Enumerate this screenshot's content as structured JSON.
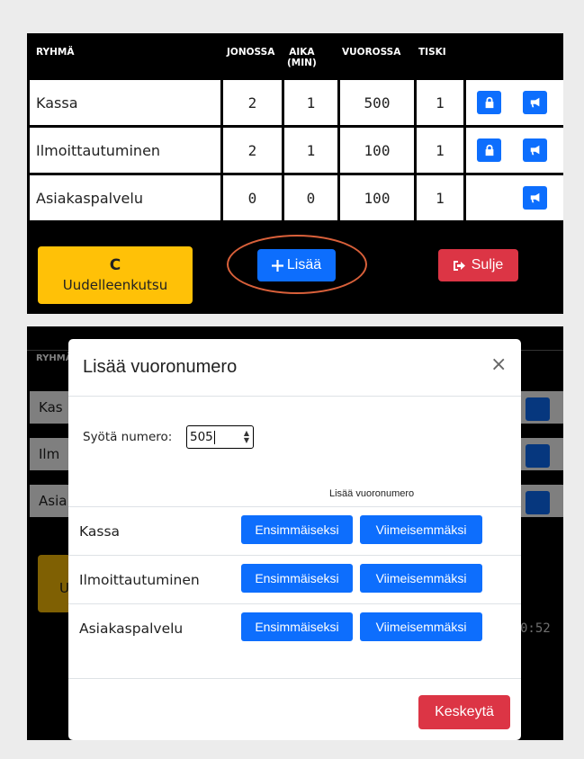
{
  "queue_table": {
    "headers": {
      "group": "RYHMÄ",
      "in_queue": "JONOSSA",
      "time_line1": "AIKA",
      "time_line2": "(MIN)",
      "current": "VUOROSSA",
      "counter": "TISKI"
    },
    "rows": [
      {
        "name": "Kassa",
        "in_queue": "2",
        "time": "1",
        "current": "500",
        "counter": "1"
      },
      {
        "name": "Ilmoittautuminen",
        "in_queue": "2",
        "time": "1",
        "current": "100",
        "counter": "1"
      },
      {
        "name": "Asiakaspalvelu",
        "in_queue": "0",
        "time": "0",
        "current": "100",
        "counter": "1"
      }
    ]
  },
  "actions": {
    "recall_icon": "C",
    "recall_label": "Uudelleenkutsu",
    "add_label": "Lisää",
    "close_label": "Sulje"
  },
  "background": {
    "header_fragment": "RYHMÄ",
    "rows": [
      "Kas",
      "Ilm",
      "Asia"
    ],
    "recall_fragment": "U",
    "time_fragment": "0:52"
  },
  "dialog": {
    "title": "Lisää vuoronumero",
    "close_symbol": "×",
    "input_label": "Syötä numero:",
    "input_value": "505",
    "column_header": "Lisää vuoronumero",
    "rows": [
      {
        "name": "Kassa",
        "first_label": "Ensimmäiseksi",
        "last_label": "Viimeisemmäksi"
      },
      {
        "name": "Ilmoittautuminen",
        "first_label": "Ensimmäiseksi",
        "last_label": "Viimeisemmäksi"
      },
      {
        "name": "Asiakaspalvelu",
        "first_label": "Ensimmäiseksi",
        "last_label": "Viimeisemmäksi"
      }
    ],
    "cancel_label": "Keskeytä"
  },
  "colors": {
    "primary": "#0d6efd",
    "warning": "#ffc107",
    "danger": "#dc3545",
    "highlight": "#d9603a"
  }
}
